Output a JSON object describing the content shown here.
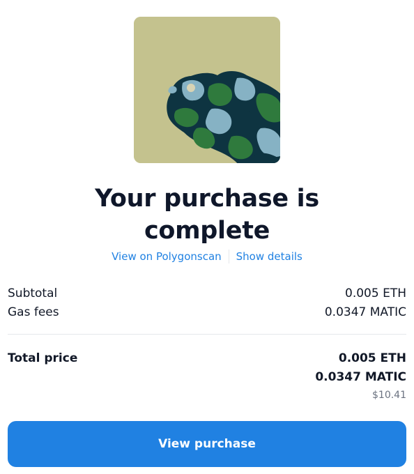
{
  "artwork": {
    "icon": "nft-artwork-image",
    "colors": {
      "background": "#c4c28e",
      "dark_teal": "#0e3441",
      "light_blue": "#86b2c4",
      "green": "#2f7a3d",
      "cream": "#d8d3b4"
    }
  },
  "title": {
    "line1": "Your purchase is",
    "line2": "complete"
  },
  "links": {
    "explorer": "View on Polygonscan",
    "details": "Show details"
  },
  "summary": {
    "subtotal_label": "Subtotal",
    "subtotal_value": "0.005 ETH",
    "gas_label": "Gas fees",
    "gas_value": "0.0347 MATIC"
  },
  "total": {
    "label": "Total price",
    "eth": "0.005 ETH",
    "matic": "0.0347 MATIC",
    "usd": "$10.41"
  },
  "cta": {
    "label": "View purchase"
  },
  "accent_color": "#2081e2"
}
